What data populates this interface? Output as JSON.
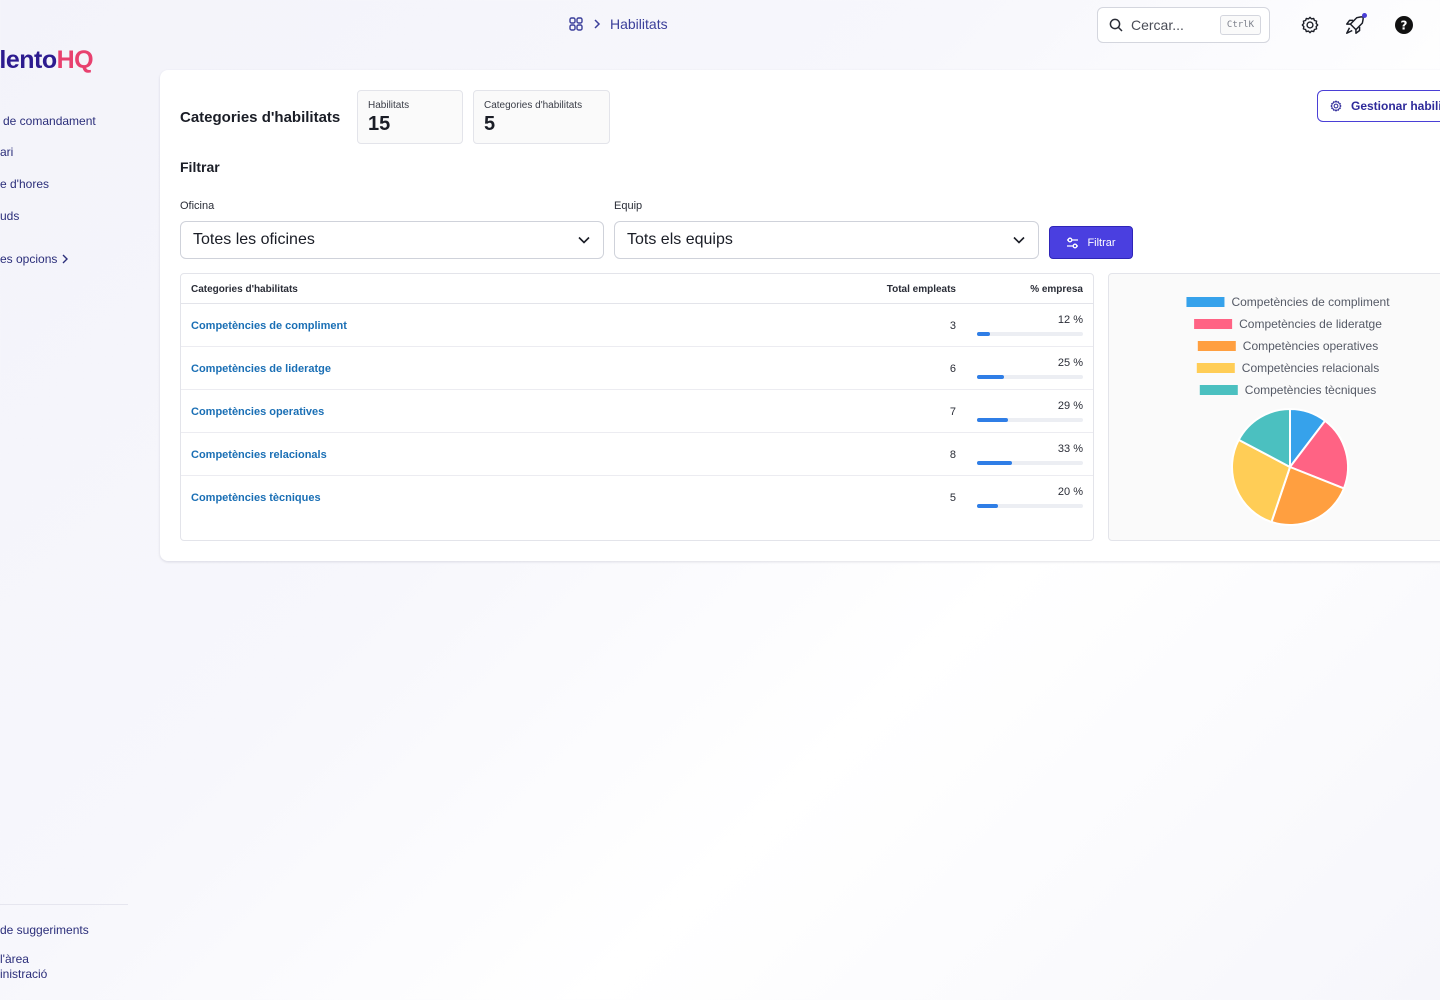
{
  "sidebar": {
    "logo_part1": "alento",
    "logo_part2": "HQ",
    "items": [
      {
        "label": "de comandament"
      },
      {
        "label": "ari"
      },
      {
        "label": "e d'hores"
      },
      {
        "label": "uds"
      },
      {
        "label": "es opcions"
      }
    ],
    "bottom": {
      "suggestions": "de suggeriments",
      "admin_line1": "l'àrea",
      "admin_line2": "inistració"
    }
  },
  "header": {
    "breadcrumb_current": "Habilitats",
    "search_placeholder": "Cercar...",
    "search_shortcut": "CtrlK"
  },
  "main": {
    "title": "Categories d'habilitats",
    "stats": [
      {
        "label": "Habilitats",
        "value": "15"
      },
      {
        "label": "Categories d'habilitats",
        "value": "5"
      }
    ],
    "manage_button": "Gestionar habilitats",
    "filter": {
      "title": "Filtrar",
      "office_label": "Oficina",
      "office_value": "Totes les oficines",
      "team_label": "Equip",
      "team_value": "Tots els equips",
      "button": "Filtrar"
    },
    "table": {
      "headers": {
        "category": "Categories d'habilitats",
        "total": "Total empleats",
        "percent": "% empresa"
      },
      "rows": [
        {
          "name": "Competències de compliment",
          "total": "3",
          "percent": "12 %",
          "fraction": 0.12
        },
        {
          "name": "Competències de lideratge",
          "total": "6",
          "percent": "25 %",
          "fraction": 0.25
        },
        {
          "name": "Competències operatives",
          "total": "7",
          "percent": "29 %",
          "fraction": 0.29
        },
        {
          "name": "Competències relacionals",
          "total": "8",
          "percent": "33 %",
          "fraction": 0.33
        },
        {
          "name": "Competències tècniques",
          "total": "5",
          "percent": "20 %",
          "fraction": 0.2
        }
      ]
    }
  },
  "chart_data": {
    "type": "pie",
    "title": "",
    "legend_placement": "top",
    "categories": [
      "Competències de compliment",
      "Competències de lideratge",
      "Competències operatives",
      "Competències relacionals",
      "Competències tècniques"
    ],
    "values": [
      3,
      6,
      7,
      8,
      5
    ],
    "colors": [
      "#36a2eb",
      "#ff6384",
      "#ff9f40",
      "#ffcd56",
      "#4bc0c0"
    ]
  },
  "colors": {
    "accent": "#4a3fe0",
    "link": "#1a6fb5",
    "progress": "#2f7ee6"
  }
}
